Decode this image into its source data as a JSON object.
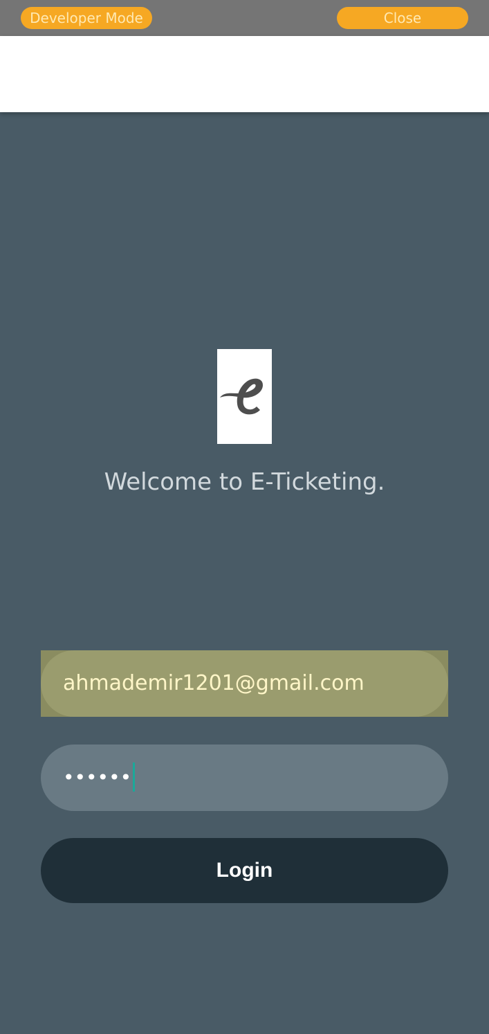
{
  "dev_bar": {
    "developer_mode_label": "Developer Mode",
    "close_label": "Close"
  },
  "logo": {
    "icon": "e-script-logo-icon"
  },
  "welcome": {
    "text": "Welcome to E-Ticketing."
  },
  "form": {
    "email_value": "ahmademir1201@gmail.com",
    "password_masked": "••••••",
    "login_label": "Login"
  },
  "colors": {
    "background": "#495b66",
    "accent_orange": "#f6a823",
    "login_button": "#1f2f38",
    "email_autofill": "#9a9c6e",
    "password_field": "#697a84",
    "caret": "#1aa99a"
  }
}
